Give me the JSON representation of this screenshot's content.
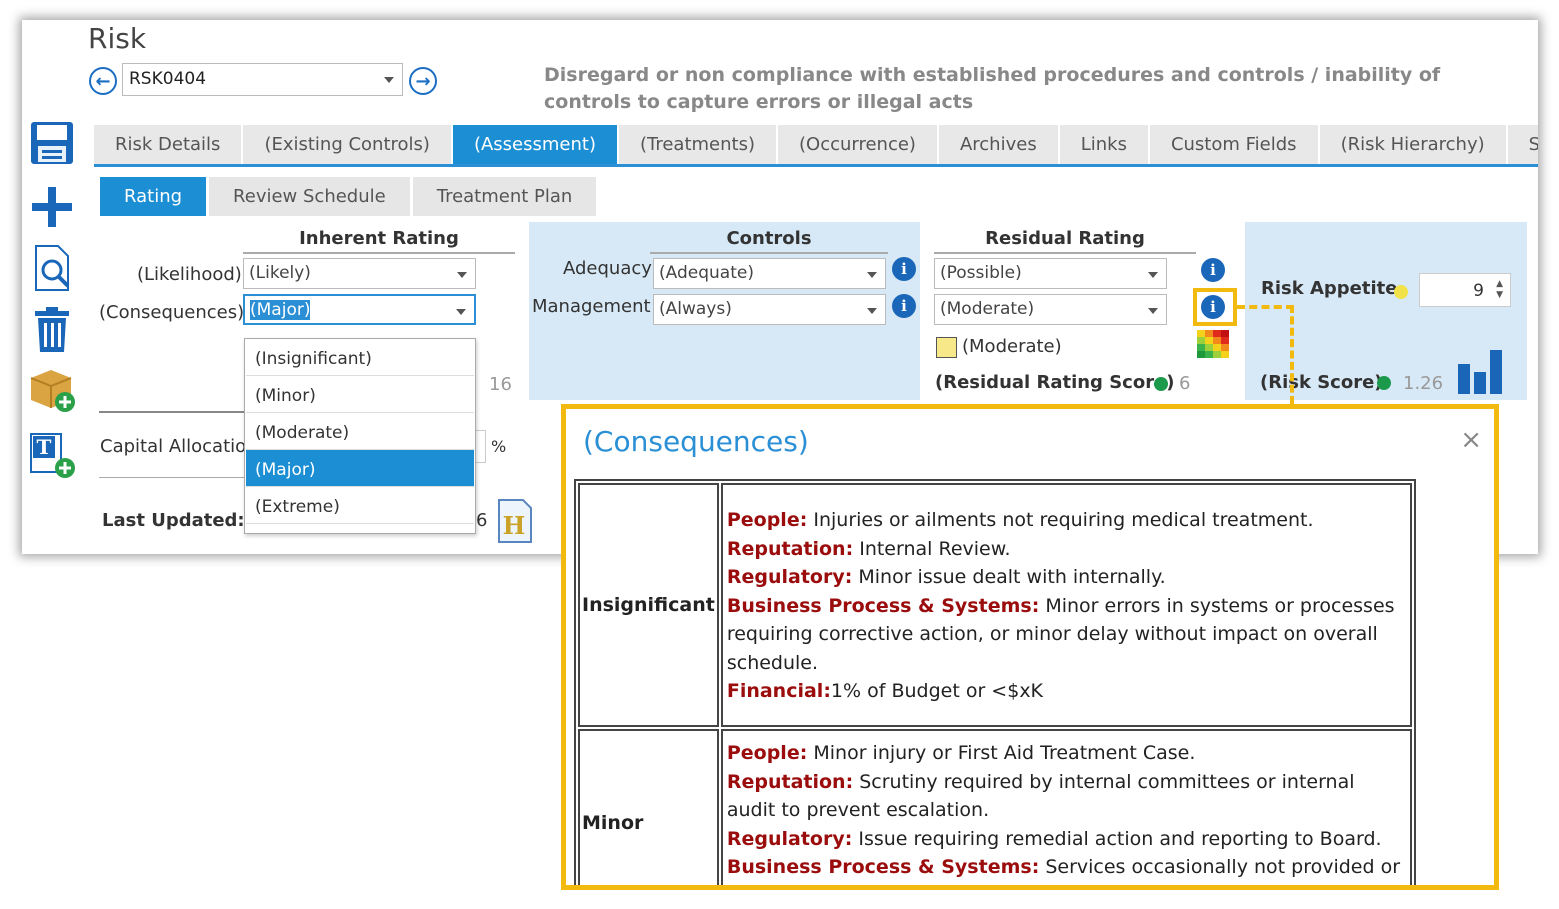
{
  "page": {
    "title": "Risk",
    "risk_id": "RSK0404",
    "description": "Disregard or non compliance with established procedures and controls / inability of controls to capture errors or illegal acts"
  },
  "tabs": [
    {
      "label": "Risk Details"
    },
    {
      "label": "(Existing Controls)"
    },
    {
      "label": "(Assessment)"
    },
    {
      "label": "(Treatments)"
    },
    {
      "label": "(Occurrence)"
    },
    {
      "label": "Archives"
    },
    {
      "label": "Links"
    },
    {
      "label": "Custom Fields"
    },
    {
      "label": "(Risk Hierarchy)"
    },
    {
      "label": "S"
    }
  ],
  "subtabs": [
    {
      "label": "Rating"
    },
    {
      "label": "Review Schedule"
    },
    {
      "label": "Treatment Plan"
    }
  ],
  "inherent": {
    "heading": "Inherent Rating",
    "likelihood_label": "(Likelihood)",
    "likelihood_value": "(Likely)",
    "consequences_label": "(Consequences)",
    "consequences_value": "(Major)",
    "score_partial": "16"
  },
  "controls": {
    "heading": "Controls",
    "adequacy_label": "Adequacy",
    "adequacy_value": "(Adequate)",
    "management_label": "Management",
    "management_value": "(Always)"
  },
  "residual": {
    "heading": "Residual Rating",
    "likelihood_value": "(Possible)",
    "consequences_value": "(Moderate)",
    "rating_label": "(Moderate)",
    "score_label": "(Residual Rating Score)",
    "score_value": "6",
    "rating_color": "#f7e98a"
  },
  "appetite": {
    "label": "Risk Appetite",
    "value": "9",
    "score_label": "(Risk Score)",
    "score_value": "1.26"
  },
  "consequence_options": [
    "(Insignificant)",
    "(Minor)",
    "(Moderate)",
    "(Major)",
    "(Extreme)"
  ],
  "capital": {
    "label": "Capital Allocation",
    "unit": "%"
  },
  "last_updated": {
    "label": "Last Updated:",
    "partial": "6"
  },
  "popup": {
    "title": "(Consequences)",
    "close": "×",
    "rows": [
      {
        "level": "Insignificant",
        "items": [
          {
            "cat": "People:",
            "text": " Injuries or ailments not requiring medical treatment."
          },
          {
            "cat": "Reputation:",
            "text": " Internal Review."
          },
          {
            "cat": "Regulatory:",
            "text": " Minor issue dealt with internally."
          },
          {
            "cat": "Business Process & Systems:",
            "text": " Minor errors in systems or processes requiring corrective action, or minor delay without impact on overall schedule."
          },
          {
            "cat": "Financial:",
            "text": "1% of Budget or <$xK"
          }
        ]
      },
      {
        "level": "Minor",
        "items": [
          {
            "cat": "People:",
            "text": " Minor injury or First Aid Treatment Case."
          },
          {
            "cat": "Reputation:",
            "text": " Scrutiny required by internal committees or internal audit to prevent escalation."
          },
          {
            "cat": "Regulatory:",
            "text": " Issue requiring remedial action and reporting to Board."
          },
          {
            "cat": "Business Process & Systems:",
            "text": " Services occasionally not provided or services do not fully meet needs."
          }
        ]
      }
    ]
  },
  "colors": {
    "accent": "#1b8ed4",
    "highlight": "#f2b90f",
    "status_green": "#1a9a4a",
    "appetite_yellow": "#f2e24a"
  }
}
